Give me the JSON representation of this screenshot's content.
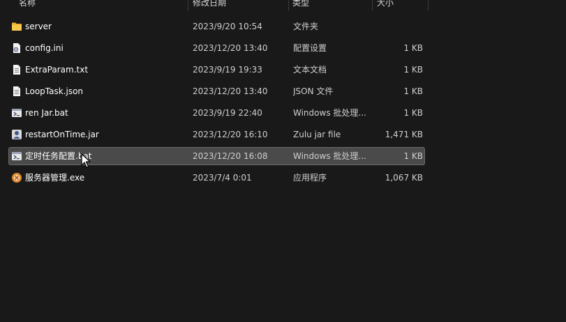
{
  "columns": {
    "name": "名称",
    "date": "修改日期",
    "type": "类型",
    "size": "大小"
  },
  "files": [
    {
      "name": "server",
      "date": "2023/9/20 10:54",
      "type": "文件夹",
      "size": "",
      "icon": "folder-icon",
      "selected": false
    },
    {
      "name": "config.ini",
      "date": "2023/12/20 13:40",
      "type": "配置设置",
      "size": "1 KB",
      "icon": "settings-file-icon",
      "selected": false
    },
    {
      "name": "ExtraParam.txt",
      "date": "2023/9/19 19:33",
      "type": "文本文档",
      "size": "1 KB",
      "icon": "text-file-icon",
      "selected": false
    },
    {
      "name": "LoopTask.json",
      "date": "2023/12/20 13:40",
      "type": "JSON 文件",
      "size": "1 KB",
      "icon": "text-file-icon",
      "selected": false
    },
    {
      "name": "ren Jar.bat",
      "date": "2023/9/19 22:40",
      "type": "Windows 批处理...",
      "size": "1 KB",
      "icon": "batch-file-icon",
      "selected": false
    },
    {
      "name": "restartOnTime.jar",
      "date": "2023/12/20 16:10",
      "type": "Zulu jar file",
      "size": "1,471 KB",
      "icon": "jar-file-icon",
      "selected": false
    },
    {
      "name": "定时任务配置.bat",
      "date": "2023/12/20 16:08",
      "type": "Windows 批处理...",
      "size": "1 KB",
      "icon": "batch-file-icon",
      "selected": true
    },
    {
      "name": "服务器管理.exe",
      "date": "2023/7/4 0:01",
      "type": "应用程序",
      "size": "1,067 KB",
      "icon": "app-exe-icon",
      "selected": false
    }
  ],
  "colors": {
    "background": "#191919",
    "selected_row": "#4a4a4a",
    "folder": "#f2b634",
    "exe_accent": "#e0892b"
  }
}
